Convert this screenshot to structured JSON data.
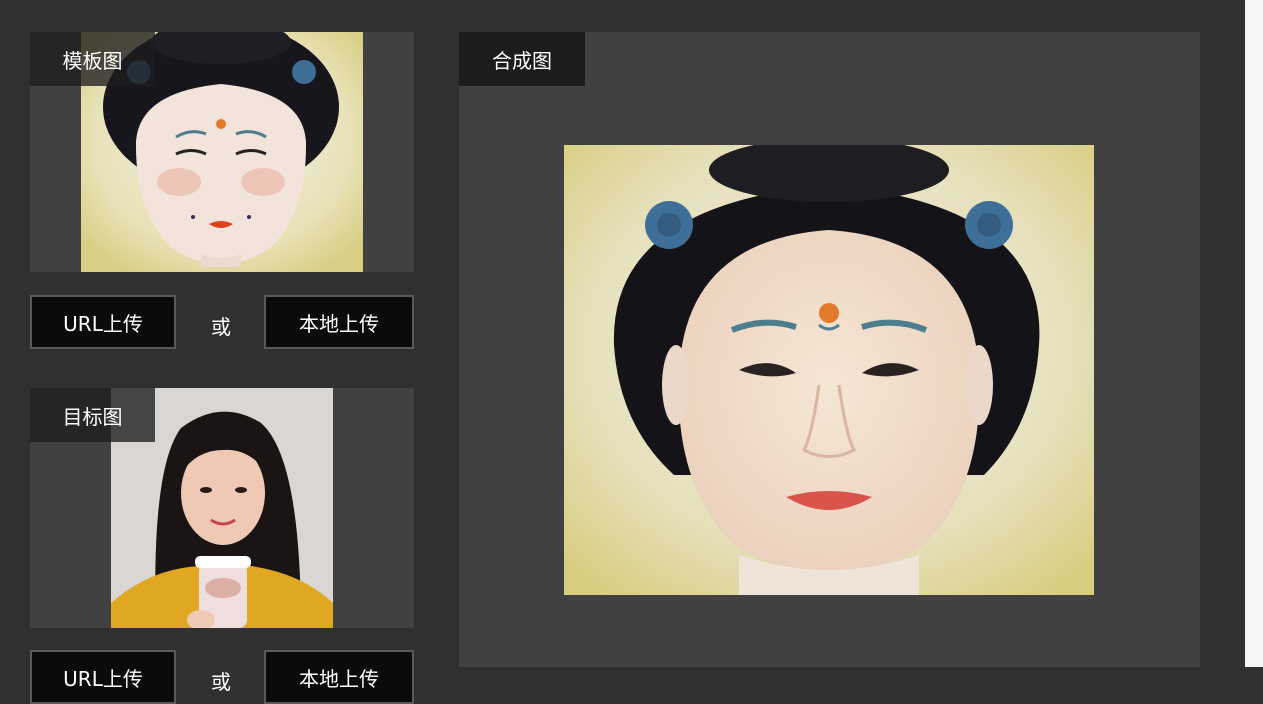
{
  "template_panel": {
    "label": "模板图",
    "image_description": "painted portrait"
  },
  "template_upload": {
    "url_button": "URL上传",
    "or_text": "或",
    "local_button": "本地上传"
  },
  "target_panel": {
    "label": "目标图",
    "image_description": "photo"
  },
  "target_upload": {
    "url_button": "URL上传",
    "or_text": "或",
    "local_button": "本地上传"
  },
  "result_panel": {
    "label": "合成图",
    "image_description": "merged portrait"
  }
}
